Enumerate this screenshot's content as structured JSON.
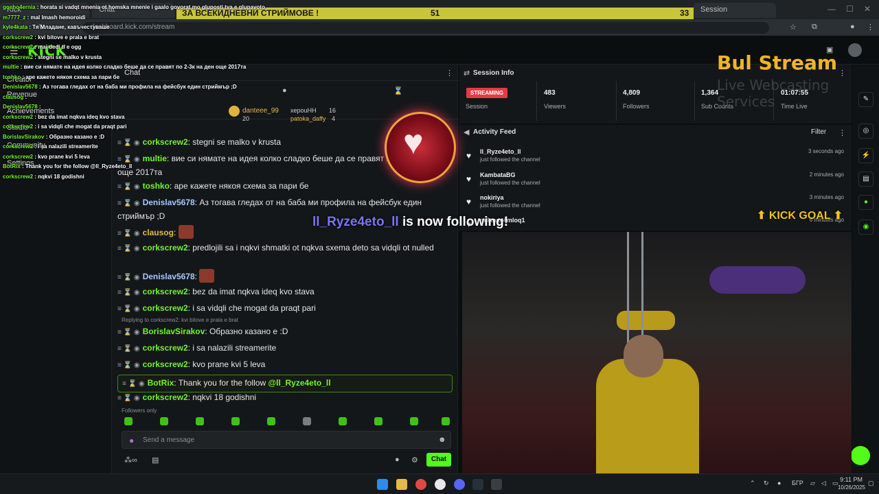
{
  "browser": {
    "tabs": [
      "Kick",
      "Chat",
      "Session"
    ],
    "url": "dashboard.kick.com/stream"
  },
  "kick": {
    "logo": "KICK",
    "sidebar": [
      "Creator",
      "Revenue",
      "Achievements",
      "Studio",
      "Community",
      "Settings"
    ]
  },
  "overlay_bar": {
    "title": "ЗА ВСЕКИДНЕВНИ СТРИЙМОВЕ !",
    "left_count": "51",
    "right_count": "33"
  },
  "overlay_chat": [
    {
      "user": "gosho4ernia",
      "text": "horata si vadqt mnenia ot homska mnenie i gaalo govorat mo gluposti tva e glupavoto"
    },
    {
      "user": "m7777_z",
      "text": "mal Imash hemoroidi"
    },
    {
      "user": "kyle4kata",
      "text": "Тя Младане, кавъчестуваше"
    },
    {
      "user": "corkscrew2",
      "text": "kvi bitove e prala e brat"
    },
    {
      "user": "corkscrew2",
      "text": "mai dedi ti e ogg"
    },
    {
      "user": "corkscrew2",
      "text": "stegni se malko v krusta"
    },
    {
      "user": "multie",
      "text": "вие си нямате на идея колко сладко беше да се правят по 2-3к на ден още 2017та"
    },
    {
      "user": "toshko",
      "text": "аре кажете някоя схема за пари бе"
    },
    {
      "user": "Denislav5678",
      "text": "Аз тогава гледах от на баба ми профила на фейсбук един стриймър ;D"
    },
    {
      "user": "clausog",
      "text": ""
    },
    {
      "user": "Denislav5678",
      "text": ""
    },
    {
      "user": "corkscrew2",
      "text": "bez da imat nqkva ideq kvo stava"
    },
    {
      "user": "corkscrew2",
      "text": "i sa vidqli che mogat da praqt pari"
    },
    {
      "user": "BorislavSirakov",
      "text": "Образно казано е :D"
    },
    {
      "user": "corkscrew2",
      "text": "i sa nalazili streamerite"
    },
    {
      "user": "corkscrew2",
      "text": "kvo prane kvi 5 leva"
    },
    {
      "user": "BotRix",
      "text": "Thank you for the follow @ll_Ryze4eto_ll"
    },
    {
      "user": "corkscrew2",
      "text": "nqkvi 18 godishni"
    }
  ],
  "brand": {
    "name": "Bul Stream",
    "sub": "Live Webcasting Services"
  },
  "chat": {
    "title": "Chat",
    "pinned": [
      {
        "user": "danteee_99",
        "count": "20"
      },
      {
        "user": "xepouHH",
        "count": "16"
      },
      {
        "user": "patoka_daffy",
        "count": "4"
      }
    ],
    "messages": [
      {
        "user": "corkscrew2",
        "color": "#72f52a",
        "text": "stegni se malko v krusta",
        "bot": false
      },
      {
        "user": "multie",
        "color": "#72f52a",
        "text": "вие си нямате на идея колко сладко беше да се правят по 2-3к на ден още 2017та",
        "bot": false
      },
      {
        "user": "toshko",
        "color": "#72f52a",
        "text": "аре кажете някоя схема за пари бе",
        "bot": false
      },
      {
        "user": "Denislav5678",
        "color": "#a6c8ff",
        "text": "Аз тогава гледах от на баба ми профила на фейсбук един стриймър ;D",
        "bot": false
      },
      {
        "user": "clausog",
        "color": "#e6b84a",
        "text": "",
        "bot": false
      },
      {
        "user": "corkscrew2",
        "color": "#72f52a",
        "text": "predlojili sa i nqkvi shmatki ot nqkva sxema deto sa vidqli ot nulled",
        "bot": false
      },
      {
        "user": "Denislav5678",
        "color": "#a6c8ff",
        "text": "",
        "bot": false
      },
      {
        "user": "corkscrew2",
        "color": "#72f52a",
        "text": "bez da imat nqkva ideq kvo stava",
        "bot": false
      },
      {
        "user": "corkscrew2",
        "color": "#72f52a",
        "text": "i sa vidqli che mogat da praqt pari",
        "bot": false
      },
      {
        "user": "BorislavSirakov",
        "color": "#72f52a",
        "text": "Образно казано е :D",
        "bot": false
      },
      {
        "user": "corkscrew2",
        "color": "#72f52a",
        "text": "i sa nalazili streamerite",
        "bot": false
      },
      {
        "user": "corkscrew2",
        "color": "#72f52a",
        "text": "kvo prane kvi 5 leva",
        "bot": false
      },
      {
        "user": "BotRix",
        "color": "#72f52a",
        "text": "Thank you for the follow",
        "mention": "@ll_Ryze4eto_ll",
        "bot": true
      },
      {
        "user": "corkscrew2",
        "color": "#72f52a",
        "text": "nqkvi 18 godishni",
        "bot": false
      }
    ],
    "replying": "Replying to corkscrew2: kvi bitove e prala e brat",
    "followers_only": "Followers only",
    "input_placeholder": "Send a message",
    "send_label": "Chat"
  },
  "session": {
    "title": "Session Info",
    "status": "STREAMING",
    "status_label": "Session",
    "stats": [
      {
        "value": "483",
        "label": "Viewers"
      },
      {
        "value": "4,809",
        "label": "Followers"
      },
      {
        "value": "1,364",
        "label": "Sub Counts"
      },
      {
        "value": "01:07:55",
        "label": "Time Live"
      }
    ]
  },
  "activity": {
    "title": "Activity Feed",
    "filter": "Filter",
    "items": [
      {
        "name": "ll_Ryze4eto_ll",
        "sub": "just followed the channel",
        "time": "3 seconds ago"
      },
      {
        "name": "KambataBG",
        "sub": "just followed the channel",
        "time": "2 minutes ago"
      },
      {
        "name": "nokiriya",
        "sub": "just followed the channel",
        "time": "3 minutes ago"
      },
      {
        "name": "milanan4mloq1",
        "sub": "",
        "time": "6 minutes ago"
      }
    ]
  },
  "alerts": {
    "follow_name": "ll_Ryze4eto_ll",
    "follow_text": "is now following!",
    "kick_goal": "KICK GOAL"
  },
  "taskbar": {
    "lang": "БГР",
    "time": "9:11 PM",
    "date": "10/26/2025"
  },
  "colors": {
    "kick_green": "#53fc18",
    "streaming_red": "#e63946",
    "brand_gold": "#f0b429",
    "bar_yellow": "#c8c53a"
  }
}
